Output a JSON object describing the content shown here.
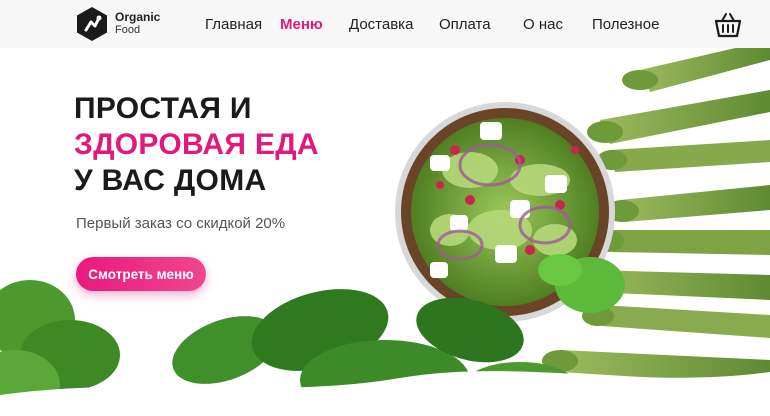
{
  "brand": {
    "name": "Organic",
    "sub": "Food"
  },
  "nav": [
    {
      "label": "Главная",
      "active": false
    },
    {
      "label": "Меню",
      "active": true
    },
    {
      "label": "Доставка",
      "active": false
    },
    {
      "label": "Оплата",
      "active": false
    },
    {
      "label": "О нас",
      "active": false
    },
    {
      "label": "Полезное",
      "active": false
    }
  ],
  "hero": {
    "line1": "ПРОСТАЯ И",
    "line2": "ЗДОРОВАЯ ЕДА",
    "line3": "У ВАС ДОМА",
    "subtitle": "Первый заказ со скидкой 20%",
    "cta": "Смотреть меню"
  },
  "colors": {
    "accent": "#e2197b",
    "leaf": "#3f8f2a",
    "asparagus": "#7aa84a"
  },
  "icons": {
    "cart": "basket-icon",
    "logo": "organic-logo-icon"
  }
}
